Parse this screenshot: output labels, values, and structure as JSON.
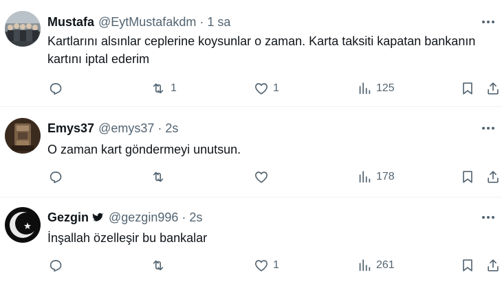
{
  "tweets": [
    {
      "name": "Mustafa",
      "verified": false,
      "handle": "@EytMustafakdm",
      "time": "1 sa",
      "text": "Kartlarını alsınlar ceplerine koysunlar o zaman. Karta taksiti kapatan bankanın kartını iptal ederim",
      "retweets": "1",
      "likes": "1",
      "views": "125"
    },
    {
      "name": "Emys37",
      "verified": false,
      "handle": "@emys37",
      "time": "2s",
      "text": "O zaman kart göndermeyi unutsun.",
      "retweets": "",
      "likes": "",
      "views": "178"
    },
    {
      "name": "Gezgin",
      "verified": true,
      "handle": "@gezgin996",
      "time": "2s",
      "text": "İnşallah özelleşir bu bankalar",
      "retweets": "",
      "likes": "1",
      "views": "261"
    }
  ],
  "separator": "·",
  "icons": {
    "reply": "reply-icon",
    "retweet": "retweet-icon",
    "like": "heart-icon",
    "views": "views-icon",
    "bookmark": "bookmark-icon",
    "share": "share-icon",
    "more": "more-icon",
    "verified": "verified-icon"
  },
  "colors": {
    "text": "#0f1419",
    "secondary": "#536471",
    "divider": "#eff3f4"
  }
}
